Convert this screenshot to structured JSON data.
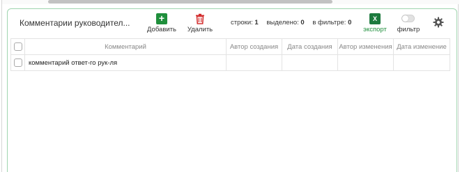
{
  "panel": {
    "title": "Комментарии руководител..."
  },
  "toolbar": {
    "add_label": "Добавить",
    "delete_label": "Удалить",
    "export_label": "экспорт",
    "filter_label": "фильтр",
    "excel_glyph": "X"
  },
  "stats": {
    "rows_label": "строки:",
    "rows_value": "1",
    "selected_label": "выделено:",
    "selected_value": "0",
    "in_filter_label": "в фильтре:",
    "in_filter_value": "0"
  },
  "table": {
    "columns": [
      "Комментарий",
      "Автор создания",
      "Дата создания",
      "Автор изменения",
      "Дата изменение"
    ],
    "rows": [
      [
        "комментарий ответ-го рук-ля",
        "",
        "",
        "",
        ""
      ]
    ]
  },
  "filter_toggle": {
    "on": false
  },
  "colors": {
    "accent_green": "#1f8f3c",
    "delete_red": "#d32f2f",
    "panel_border": "#9fd5ae"
  },
  "icons": [
    "add-icon",
    "trash-icon",
    "excel-icon",
    "toggle-switch",
    "gear-icon"
  ]
}
